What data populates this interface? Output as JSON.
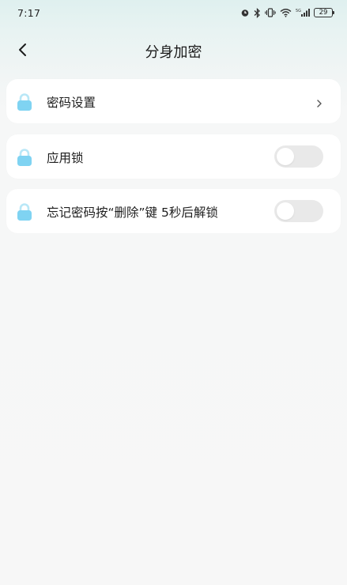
{
  "status_bar": {
    "time": "7:17",
    "battery": "29"
  },
  "header": {
    "title": "分身加密"
  },
  "settings": {
    "items": [
      {
        "label": "密码设置",
        "control": "chevron",
        "icon": "lock-icon"
      },
      {
        "label": "应用锁",
        "control": "toggle",
        "enabled": false,
        "icon": "lock-icon"
      },
      {
        "label": "忘记密码按“删除”键 5秒后解锁",
        "control": "toggle",
        "enabled": false,
        "icon": "lock-icon"
      }
    ]
  },
  "colors": {
    "lock_body": "#7fd3f2",
    "lock_shackle": "#b8e7f7",
    "toggle_off": "#e9e9e9"
  }
}
